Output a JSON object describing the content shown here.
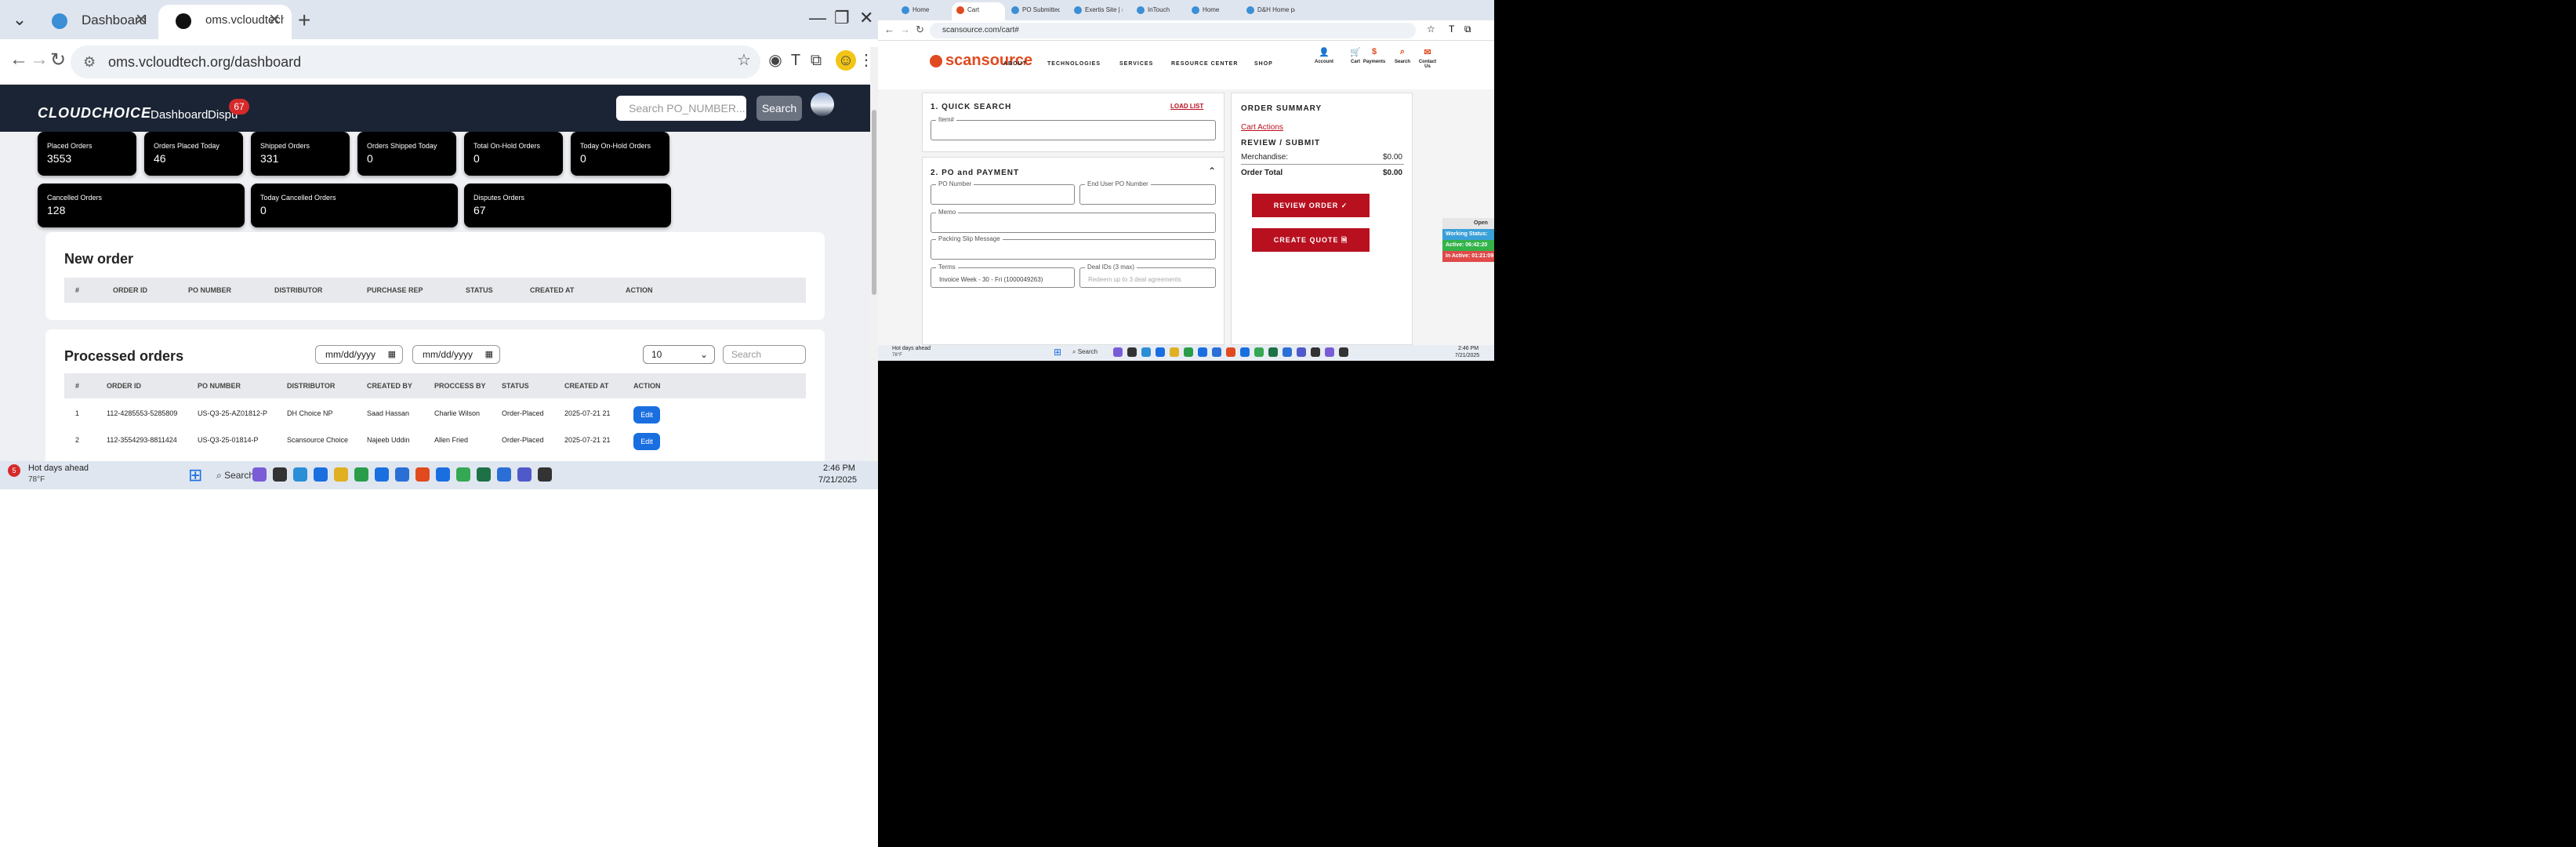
{
  "left": {
    "tabs": [
      {
        "label": "Dashboard",
        "active": false
      },
      {
        "label": "oms.vcloudtech.org/dashboard",
        "active": true
      }
    ],
    "url": "oms.vcloudtech.org/dashboard",
    "header": {
      "logo": "CLOUDCHOICE",
      "nav_dashboard": "Dashboard",
      "nav_disputes": "Dispu",
      "disputes_badge": "67",
      "search_placeholder": "Search PO_NUMBER...",
      "search_button": "Search"
    },
    "stats_row1": [
      {
        "label": "Placed Orders",
        "value": "3553"
      },
      {
        "label": "Orders Placed Today",
        "value": "46"
      },
      {
        "label": "Shipped Orders",
        "value": "331"
      },
      {
        "label": "Orders Shipped Today",
        "value": "0"
      },
      {
        "label": "Total On-Hold Orders",
        "value": "0"
      },
      {
        "label": "Today On-Hold Orders",
        "value": "0"
      }
    ],
    "stats_row2": [
      {
        "label": "Cancelled Orders",
        "value": "128"
      },
      {
        "label": "Today Cancelled Orders",
        "value": "0"
      },
      {
        "label": "Disputes Orders",
        "value": "67"
      }
    ],
    "new_order": {
      "title": "New order",
      "columns": [
        "#",
        "ORDER ID",
        "PO NUMBER",
        "DISTRIBUTOR",
        "PURCHASE REP",
        "STATUS",
        "CREATED AT",
        "ACTION"
      ]
    },
    "processed": {
      "title": "Processed orders",
      "date_from": "mm/dd/yyyy",
      "date_to": "mm/dd/yyyy",
      "page_size": "10",
      "search_placeholder": "Search",
      "columns": [
        "#",
        "ORDER ID",
        "PO NUMBER",
        "DISTRIBUTOR",
        "CREATED BY",
        "PROCCESS BY",
        "STATUS",
        "CREATED AT",
        "ACTION"
      ],
      "rows": [
        [
          "1",
          "112-4285553-5285809",
          "US-Q3-25-AZ01812-P",
          "DH Choice NP",
          "Saad Hassan",
          "Charlie Wilson",
          "Order-Placed",
          "2025-07-21 21",
          "Edit"
        ],
        [
          "2",
          "112-3554293-8811424",
          "US-Q3-25-01814-P",
          "Scansource Choice",
          "Najeeb Uddin",
          "Allen Fried",
          "Order-Placed",
          "2025-07-21 21",
          "Edit"
        ]
      ]
    },
    "taskbar": {
      "weather_title": "Hot days ahead",
      "weather_temp": "78°F",
      "weather_badge": "5",
      "search": "Search",
      "time": "2:46 PM",
      "date": "7/21/2025"
    }
  },
  "right": {
    "tabs": [
      {
        "label": "Home",
        "active": false
      },
      {
        "label": "Cart",
        "active": true
      },
      {
        "label": "PO Submitted-",
        "active": false
      },
      {
        "label": "Exertis Site | Ho",
        "active": false
      },
      {
        "label": "InTouch",
        "active": false
      },
      {
        "label": "Home",
        "active": false
      },
      {
        "label": "D&H Home pag",
        "active": false
      }
    ],
    "url": "scansource.com/cart#",
    "logo": "scansource",
    "nav": [
      "ABOUT",
      "TECHNOLOGIES",
      "SERVICES",
      "RESOURCE CENTER",
      "SHOP"
    ],
    "icons": [
      "Account",
      "Cart",
      "Payments",
      "Search",
      "Contact Us"
    ],
    "quick_search": {
      "title": "1. QUICK SEARCH",
      "load_list": "LOAD LIST",
      "item_label": "Item#"
    },
    "po_payment": {
      "title": "2. PO and PAYMENT",
      "po_label": "PO Number",
      "end_user_label": "End User PO Number",
      "memo_label": "Memo",
      "packing_label": "Packing Slip Message",
      "terms_label": "Terms",
      "terms_value": "Invoice Week - 30 - Fri (1000049263)",
      "deal_label": "Deal IDs (3 max)",
      "deal_placeholder": "Redeem up to 3 deal agreements"
    },
    "summary": {
      "title": "ORDER SUMMARY",
      "cart_actions": "Cart Actions",
      "review_title": "REVIEW / SUBMIT",
      "merch_label": "Merchandise:",
      "merch_value": "$0.00",
      "total_label": "Order Total",
      "total_value": "$0.00",
      "review_btn": "REVIEW ORDER ✓",
      "quote_btn": "CREATE QUOTE 🗎"
    },
    "side_widget": {
      "open": "Open Ap",
      "working": "Working Status: Activ",
      "active": "Active: 06:42:20",
      "inactive": "In Active: 01:21:09"
    },
    "taskbar": {
      "weather_title": "Hot days ahead",
      "weather_temp": "78°F",
      "search": "Search",
      "time": "2:46 PM",
      "date": "7/21/2025"
    }
  }
}
